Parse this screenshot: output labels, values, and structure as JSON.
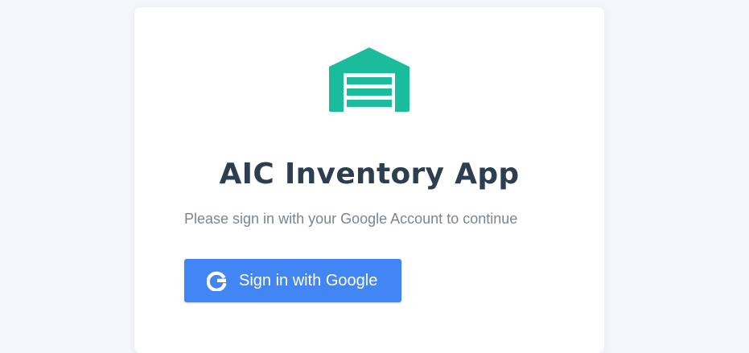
{
  "app": {
    "title": "AIC Inventory App",
    "subtitle": "Please sign in with your Google Account to continue",
    "logo_icon": "warehouse-icon"
  },
  "signin": {
    "button_label": "Sign in with Google",
    "icon": "google-icon"
  },
  "colors": {
    "accent": "#1abc9c",
    "button": "#4285f4",
    "title": "#2c3e50",
    "subtitle": "#7b8590",
    "background": "#f5f6fa"
  }
}
